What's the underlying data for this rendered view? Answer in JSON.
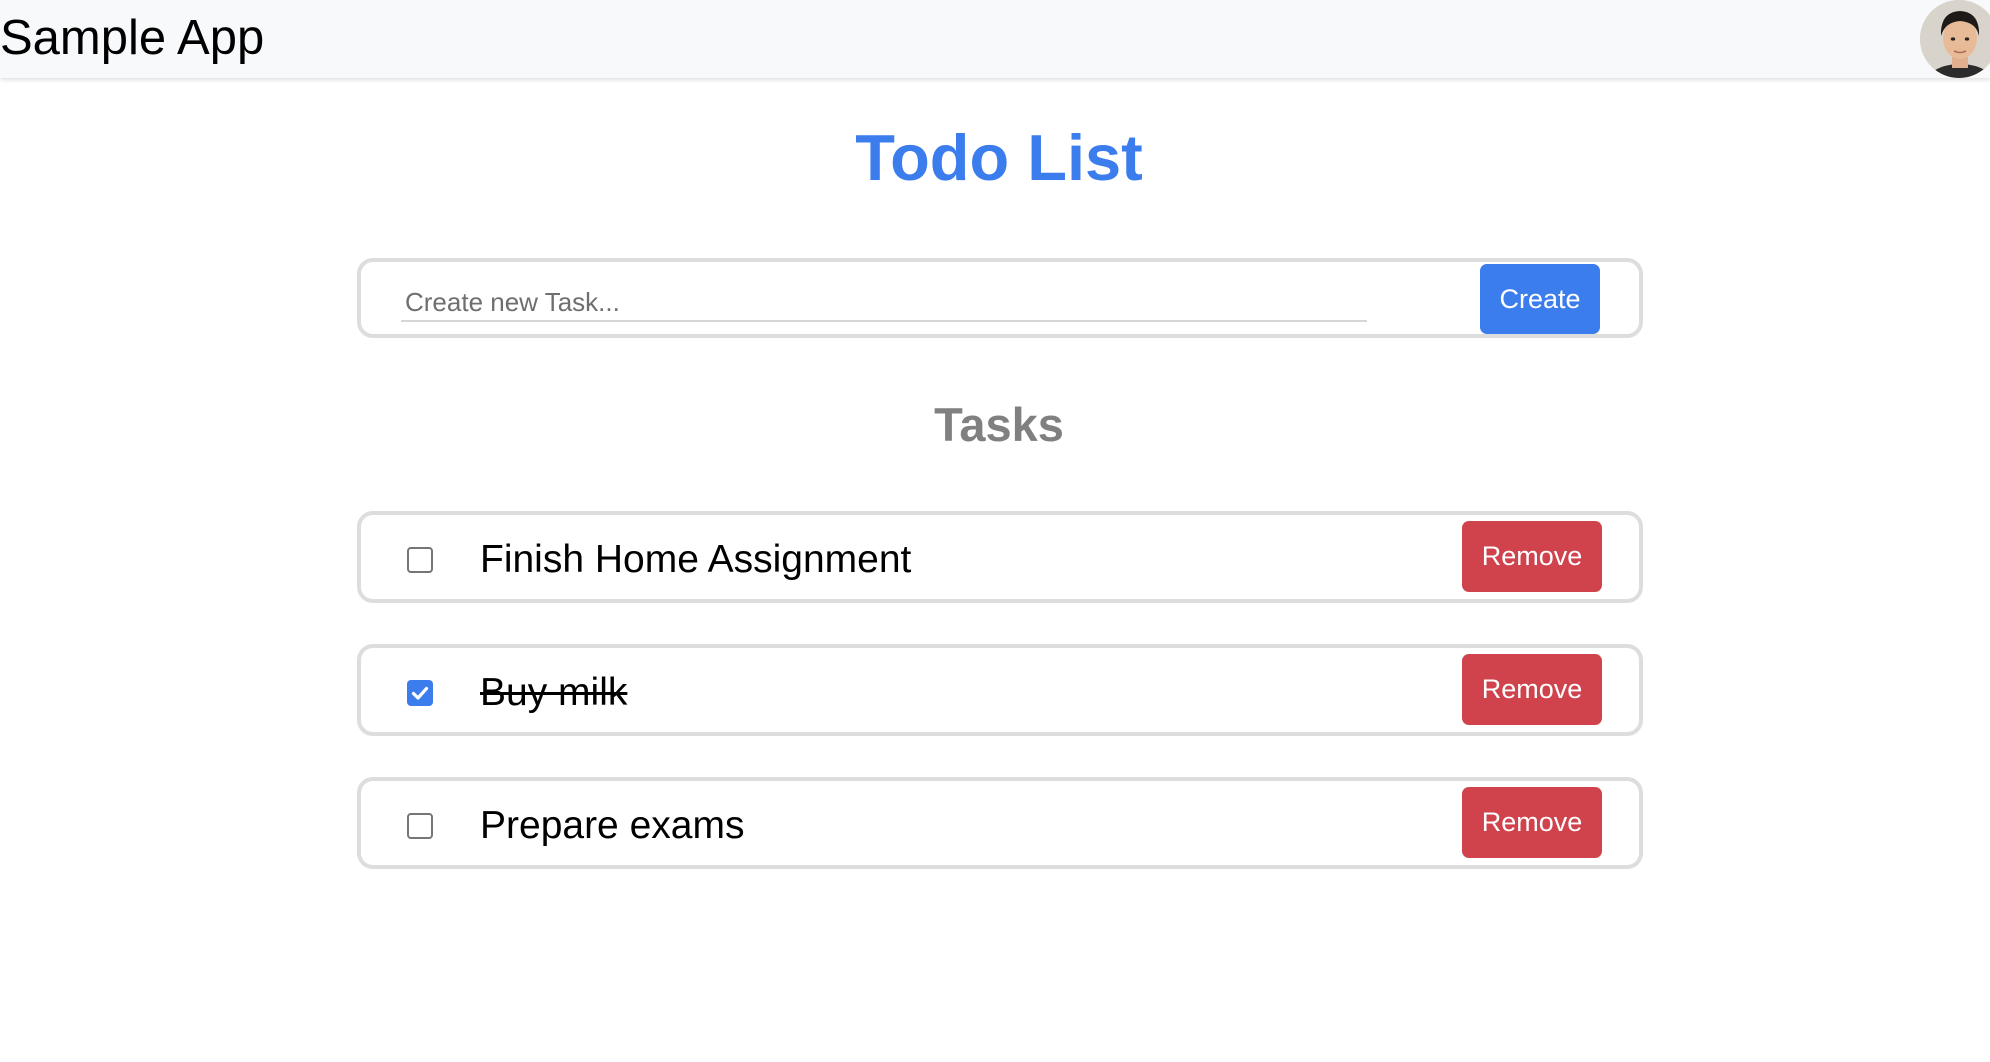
{
  "navbar": {
    "brand": "Sample App"
  },
  "page": {
    "title": "Todo List"
  },
  "create_form": {
    "placeholder": "Create new Task...",
    "value": "",
    "button_label": "Create"
  },
  "tasks_section": {
    "heading": "Tasks",
    "items": [
      {
        "label": "Finish Home Assignment",
        "completed": false,
        "remove_label": "Remove"
      },
      {
        "label": "Buy milk",
        "completed": true,
        "remove_label": "Remove"
      },
      {
        "label": "Prepare exams",
        "completed": false,
        "remove_label": "Remove"
      }
    ]
  },
  "colors": {
    "primary": "#3b7ded",
    "danger": "#d0424c",
    "heading_gray": "#808080",
    "navbar_bg": "#f8f9fa",
    "card_border": "#dddddd"
  },
  "icons": {
    "avatar": "user-avatar-photo",
    "check": "checkmark-icon"
  }
}
